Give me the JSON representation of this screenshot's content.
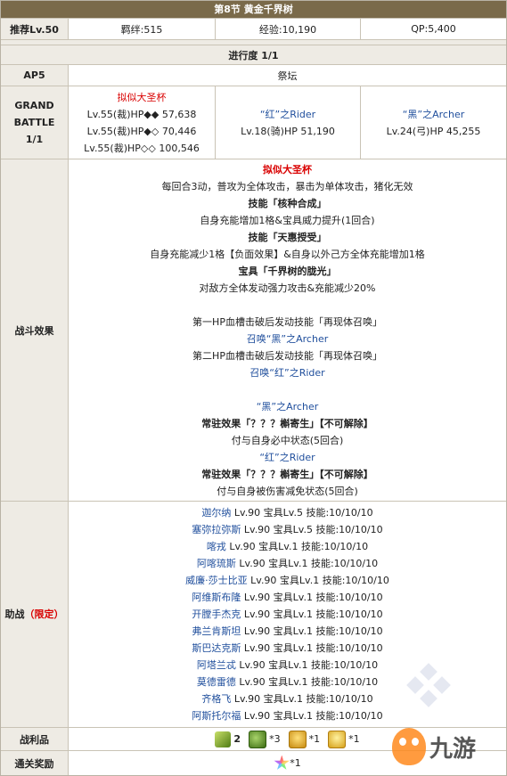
{
  "header": {
    "title": "第8节 黄金千界树"
  },
  "stats": {
    "recommend_label": "推荐Lv.50",
    "bond": "羁绊:515",
    "exp": "经验:10,190",
    "qp": "QP:5,400"
  },
  "progress": {
    "text": "进行度 1/1"
  },
  "ap": {
    "label": "AP5",
    "location": "祭坛"
  },
  "battle": {
    "label_lines": [
      "GRAND",
      "BATTLE",
      "1/1"
    ],
    "enemies": [
      {
        "name": "拟似大圣杯",
        "lines": [
          "Lv.55(裁)HP◆◆ 57,638",
          "Lv.55(裁)HP◆◇ 70,446",
          "Lv.55(裁)HP◇◇ 100,546"
        ]
      },
      {
        "name": "“红”之Rider",
        "lines": [
          "Lv.18(骑)HP 51,190"
        ]
      },
      {
        "name": "“黑”之Archer",
        "lines": [
          "Lv.24(弓)HP 45,255"
        ]
      }
    ]
  },
  "effects": {
    "label": "战斗效果",
    "lines": [
      {
        "text": "拟似大圣杯",
        "style": "red b"
      },
      {
        "text": "每回合3动，普攻为全体攻击，暴击为单体攻击，猪化无效",
        "style": ""
      },
      {
        "text": "技能「核种合成」",
        "style": "b"
      },
      {
        "text": "自身充能增加1格&宝具威力提升(1回合)",
        "style": ""
      },
      {
        "text": "技能「天惠授受」",
        "style": "b"
      },
      {
        "text": "自身充能减少1格【负面效果】&自身以外己方全体充能增加1格",
        "style": ""
      },
      {
        "text": "宝具「千界树的胧光」",
        "style": "b"
      },
      {
        "text": "对敌方全体发动强力攻击&充能减少20%",
        "style": ""
      },
      {
        "text": "",
        "style": ""
      },
      {
        "text": "第一HP血槽击破后发动技能「再现体召唤」",
        "style": "mix1"
      },
      {
        "text": "召唤“黑”之Archer",
        "style": "mix2"
      },
      {
        "text": "第二HP血槽击破后发动技能「再现体召唤」",
        "style": "mix1"
      },
      {
        "text": "召唤“红”之Rider",
        "style": "mix3"
      },
      {
        "text": "",
        "style": ""
      },
      {
        "text": "“黑”之Archer",
        "style": "blue"
      },
      {
        "text": "常驻效果「？？？槲寄生」【不可解除】",
        "style": "b"
      },
      {
        "text": "付与自身必中状态(5回合)",
        "style": ""
      },
      {
        "text": "“红”之Rider",
        "style": "blue"
      },
      {
        "text": "常驻效果「？？？槲寄生」【不可解除】",
        "style": "b"
      },
      {
        "text": "付与自身被伤害减免状态(5回合)",
        "style": ""
      }
    ]
  },
  "support": {
    "label": "助战",
    "label_note": "（限定）",
    "items": [
      {
        "name": "迦尔纳",
        "detail": "Lv.90 宝具Lv.5 技能:10/10/10"
      },
      {
        "name": "塞弥拉弥斯",
        "detail": "Lv.90 宝具Lv.5 技能:10/10/10"
      },
      {
        "name": "喀戎",
        "detail": "Lv.90 宝具Lv.1 技能:10/10/10"
      },
      {
        "name": "阿喀琉斯",
        "detail": "Lv.90 宝具Lv.1 技能:10/10/10"
      },
      {
        "name": "威廉·莎士比亚",
        "detail": "Lv.90 宝具Lv.1 技能:10/10/10"
      },
      {
        "name": "阿维斯布隆",
        "detail": "Lv.90 宝具Lv.1 技能:10/10/10"
      },
      {
        "name": "开膛手杰克",
        "detail": "Lv.90 宝具Lv.1 技能:10/10/10"
      },
      {
        "name": "弗兰肯斯坦",
        "detail": "Lv.90 宝具Lv.1 技能:10/10/10"
      },
      {
        "name": "斯巴达克斯",
        "detail": "Lv.90 宝具Lv.1 技能:10/10/10"
      },
      {
        "name": "阿塔兰忒",
        "detail": "Lv.90 宝具Lv.1 技能:10/10/10"
      },
      {
        "name": "莫德雷德",
        "detail": "Lv.90 宝具Lv.1 技能:10/10/10"
      },
      {
        "name": "齐格飞",
        "detail": "Lv.90 宝具Lv.1 技能:10/10/10"
      },
      {
        "name": "阿斯托尔福",
        "detail": "Lv.90 宝具Lv.1 技能:10/10/10"
      }
    ]
  },
  "loot": {
    "label": "战利品",
    "items": [
      {
        "icon": "green-gem-icon",
        "count": "2"
      },
      {
        "icon": "green-leaf-icon",
        "count": "*3"
      },
      {
        "icon": "gold-statue-icon",
        "count": "*1"
      },
      {
        "icon": "gold-monument-icon",
        "count": "*1"
      }
    ]
  },
  "reward": {
    "label": "通关奖励",
    "icon": "saint-quartz-icon",
    "count": "*1"
  },
  "watermark": {
    "text": "九游"
  },
  "colors": {
    "header_bg": "#7a6a4a",
    "label_bg": "#eeebe4",
    "red": "#d90000",
    "blue": "#1f4e9c"
  }
}
